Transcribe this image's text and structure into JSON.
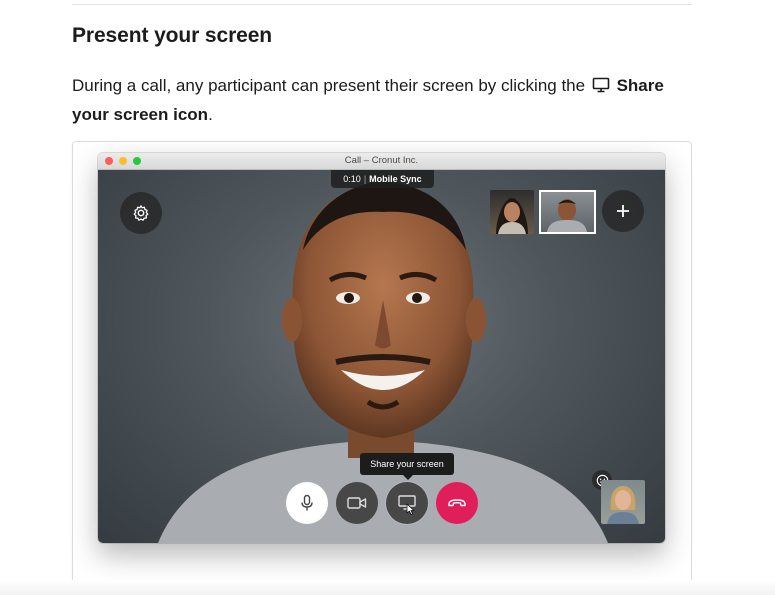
{
  "article": {
    "heading": "Present your screen",
    "paragraph_before": "During a call, any participant can present their screen by clicking the",
    "paragraph_bold": "Share your screen icon",
    "paragraph_after": "."
  },
  "window": {
    "title": "Call – Cronut Inc."
  },
  "call": {
    "timer": "0:10",
    "channel": "Mobile Sync"
  },
  "tooltip": {
    "text": "Share your screen"
  },
  "controls": [
    {
      "name": "microphone",
      "icon": "mic-icon"
    },
    {
      "name": "video",
      "icon": "video-camera-icon"
    },
    {
      "name": "share-screen",
      "icon": "monitor-icon"
    },
    {
      "name": "hang-up",
      "icon": "phone-hangup-icon"
    }
  ],
  "colors": {
    "hangup_red": "#e01e5a",
    "button_dark": "#3c3c3c",
    "traffic_red": "#fc5f57",
    "traffic_yellow": "#fdbc2e",
    "traffic_green": "#28c840"
  }
}
